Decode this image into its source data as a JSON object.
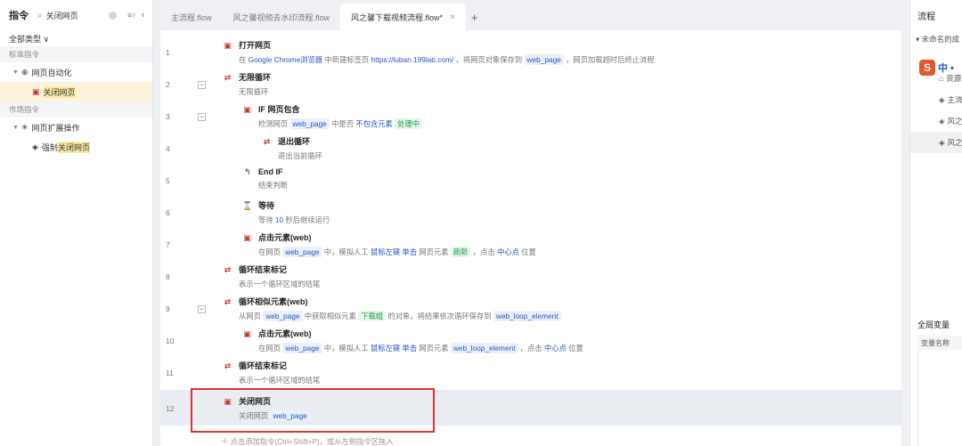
{
  "left": {
    "title": "指令",
    "search_value": "关闭网页",
    "sort_icon": "≡↑",
    "collapse_icon": "‹",
    "category": "全部类型 ∨",
    "section_standard": "标准指令",
    "group_web": "网页自动化",
    "leaf_close": "关闭网页",
    "section_market": "市场指令",
    "group_ext": "网页扩展操作",
    "leaf_force_prefix": "强制",
    "leaf_force_hl": "关闭网页"
  },
  "tabs": [
    {
      "label": "主流程.flow"
    },
    {
      "label": "风之馨视频去水印流程.flow"
    },
    {
      "label": "风之馨下载视频流程.flow*"
    }
  ],
  "tab_add": "+",
  "tab_close": "×",
  "lines": [
    "1",
    "2",
    "3",
    "4",
    "5",
    "6",
    "7",
    "8",
    "9",
    "10",
    "11",
    "12"
  ],
  "cmds": {
    "c1_title": "打开网页",
    "c1_a": "在 ",
    "c1_b": "Google Chrome浏览器",
    "c1_c": " 中新建标签页 ",
    "c1_d": "https://luban.199lab.com/",
    "c1_e": " ，将网页对象保存到 ",
    "c1_f": "web_page",
    "c1_g": " ，网页加载超时后终止流程",
    "c2_title": "无限循环",
    "c2_desc": "无限循环",
    "c3_title": "IF 网页包含",
    "c3_a": "检测网页 ",
    "c3_b": "web_page",
    "c3_c": " 中是否 ",
    "c3_d": "不包含元素",
    "c3_e": "处理中",
    "c4_title": "退出循环",
    "c4_desc": "退出当前循环",
    "c5_title": "End IF",
    "c5_desc": "结束判断",
    "c6_title": "等待",
    "c6_a": "等待 ",
    "c6_b": "10",
    "c6_c": " 秒后继续运行",
    "c7_title": "点击元素(web)",
    "c7_a": "在网页 ",
    "c7_b": "web_page",
    "c7_c": " 中，模拟人工 ",
    "c7_d": "鼠标左键",
    "c7_e": "单击",
    "c7_f": " 网页元素 ",
    "c7_g": "刷新",
    "c7_h": " ，点击 ",
    "c7_i": "中心点",
    "c7_j": " 位置",
    "c8_title": "循环结束标记",
    "c8_desc": "表示一个循环区域的结尾",
    "c9_title": "循环相似元素(web)",
    "c9_a": "从网页 ",
    "c9_b": "web_page",
    "c9_c": " 中获取相似元素 ",
    "c9_d": "下载组",
    "c9_e": " 的对象，将结果依次循环保存到 ",
    "c9_f": "web_loop_element",
    "c10_title": "点击元素(web)",
    "c10_a": "在网页 ",
    "c10_b": "web_page",
    "c10_c": " 中，模拟人工 ",
    "c10_d": "鼠标左键",
    "c10_e": "单击",
    "c10_f": " 网页元素 ",
    "c10_g": "web_loop_element",
    "c10_h": " ，点击 ",
    "c10_i": "中心点",
    "c10_j": " 位置",
    "c11_title": "循环结束标记",
    "c11_desc": "表示一个循环区域的结尾",
    "c12_title": "关闭网页",
    "c12_a": "关闭网页 ",
    "c12_b": "web_page"
  },
  "add_hint": "＋ 点击添加指令(Ctrl+Shift+P)，或从左侧指令区拖入",
  "right": {
    "title": "流程",
    "project": "▾ 未命名的成",
    "items": [
      "资源",
      "主流",
      "风之",
      "风之"
    ],
    "global_vars_title": "全局变量",
    "var_name_header": "变量名称",
    "sogou_s": "S",
    "sogou_text": "中 •"
  },
  "colors": {
    "accent": "#1f56c9",
    "highlight_box": "#e03131",
    "selected_bg": "#fdf3dc"
  }
}
